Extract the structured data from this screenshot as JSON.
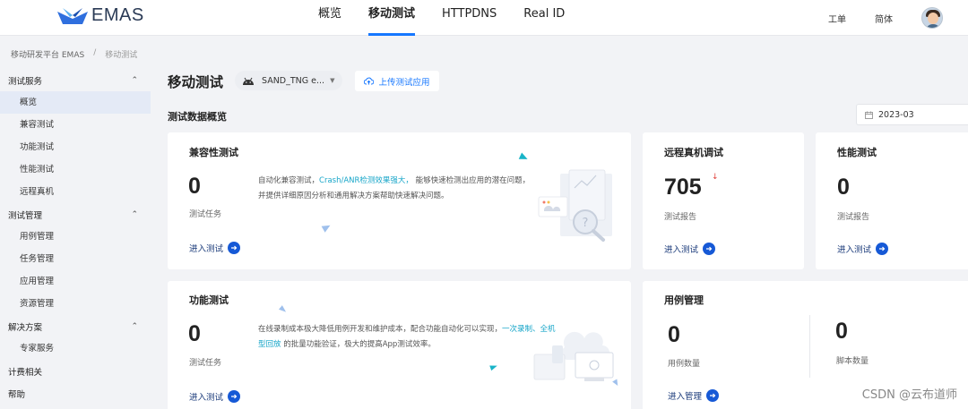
{
  "brand": {
    "name": "EMAS"
  },
  "nav": {
    "items": [
      {
        "label": "概览"
      },
      {
        "label": "移动测试"
      },
      {
        "label": "HTTPDNS"
      },
      {
        "label": "Real ID"
      }
    ],
    "active": "移动测试",
    "ticket_label": "工单",
    "lang_label": "简体"
  },
  "breadcrumb": {
    "root": "移动研发平台 EMAS",
    "sep": "/",
    "current": "移动测试"
  },
  "sidebar": {
    "groups": [
      {
        "label": "测试服务",
        "expanded": true,
        "items": [
          {
            "label": "概览",
            "active": true
          },
          {
            "label": "兼容测试"
          },
          {
            "label": "功能测试"
          },
          {
            "label": "性能测试"
          },
          {
            "label": "远程真机"
          }
        ]
      },
      {
        "label": "测试管理",
        "expanded": true,
        "items": [
          {
            "label": "用例管理"
          },
          {
            "label": "任务管理"
          },
          {
            "label": "应用管理"
          },
          {
            "label": "资源管理"
          }
        ]
      },
      {
        "label": "解决方案",
        "expanded": true,
        "items": [
          {
            "label": "专家服务"
          }
        ]
      },
      {
        "label": "计费相关"
      },
      {
        "label": "帮助"
      }
    ]
  },
  "header": {
    "title": "移动测试",
    "app_select": "SAND_TNG e...",
    "upload_label": "上传测试应用"
  },
  "overview": {
    "title": "测试数据概览",
    "date": "2023-03"
  },
  "cards": {
    "compat": {
      "title": "兼容性测试",
      "value": "0",
      "label": "测试任务",
      "desc_pre": "自动化兼容测试，",
      "desc_hl": "Crash/ANR检测效果强大，",
      "desc_post": " 能够快速检测出应用的潜在问题，并提供详细原因分析和通用解决方案帮助快速解决问题。",
      "link": "进入测试"
    },
    "remote": {
      "title": "远程真机调试",
      "value": "705",
      "label": "测试报告",
      "link": "进入测试"
    },
    "perf": {
      "title": "性能测试",
      "value": "0",
      "label": "测试报告",
      "link": "进入测试"
    },
    "func": {
      "title": "功能测试",
      "value": "0",
      "label": "测试任务",
      "desc_pre": "在线录制成本极大降低用例开发和维护成本，配合功能自动化可以实现，",
      "desc_hl": "一次录制、全机型回放",
      "desc_post": " 的批量功能验证，极大的提高App测试效率。",
      "link": "进入测试"
    },
    "cases": {
      "title": "用例管理",
      "value": "0",
      "label": "用例数量",
      "value2": "0",
      "label2": "脚本数量",
      "link": "进入管理"
    }
  },
  "watermark": "CSDN @云布道师",
  "colors": {
    "accent": "#1677ff",
    "highlight": "#18a6c9",
    "link_dark": "#1a3a7a"
  }
}
